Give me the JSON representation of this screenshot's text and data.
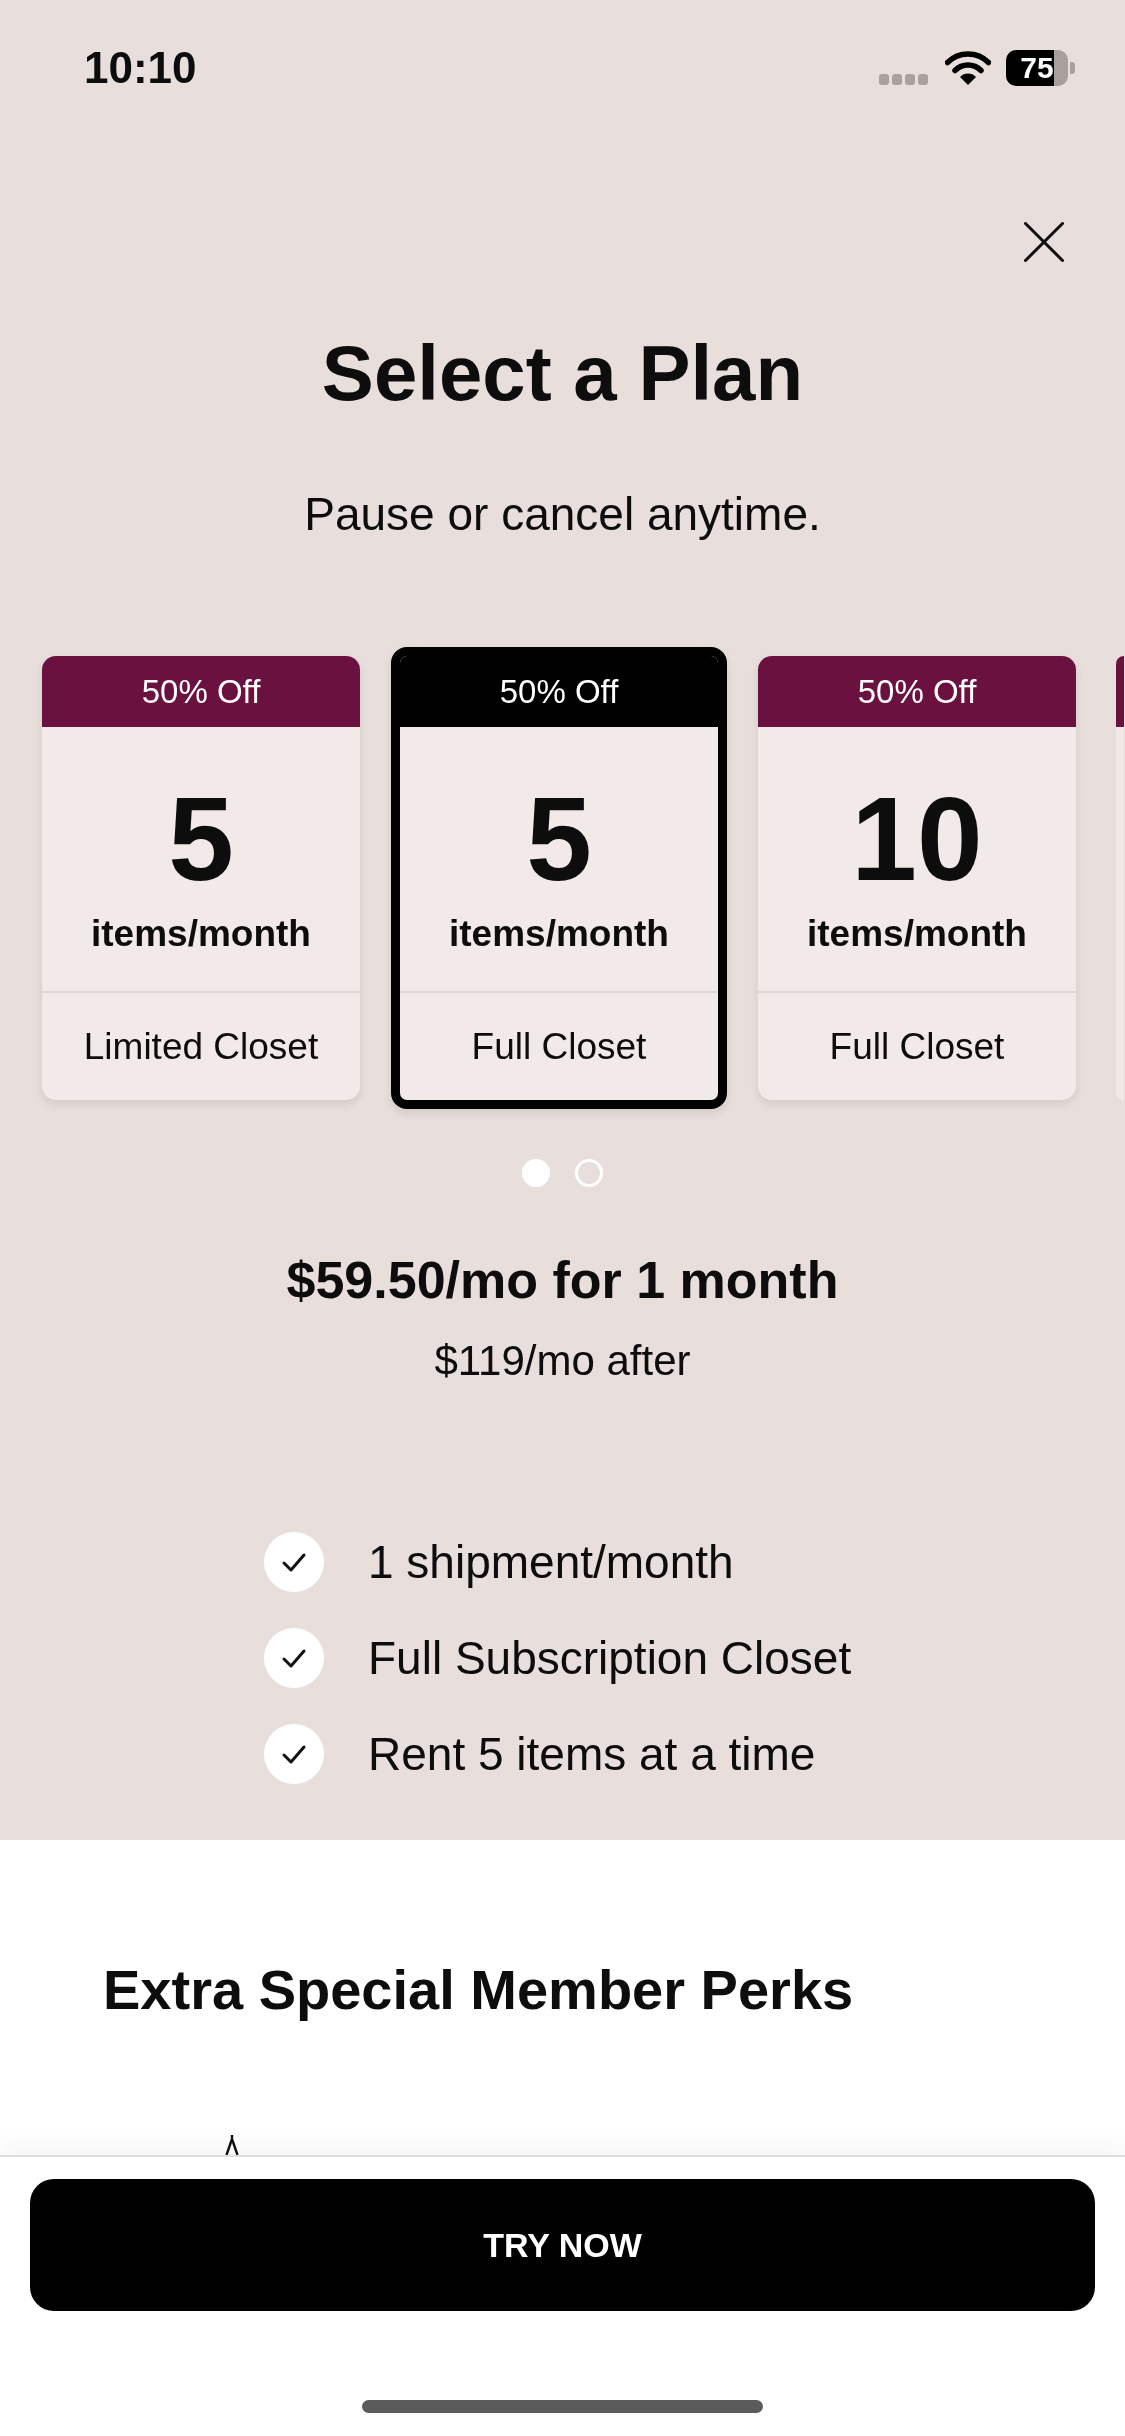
{
  "status_bar": {
    "time": "10:10",
    "battery": "75"
  },
  "title": "Select a Plan",
  "subtitle": "Pause or cancel anytime.",
  "plans": [
    {
      "badge": "50% Off",
      "count": "5",
      "unit": "items/month",
      "closet": "Limited Closet",
      "selected": false
    },
    {
      "badge": "50% Off",
      "count": "5",
      "unit": "items/month",
      "closet": "Full Closet",
      "selected": true
    },
    {
      "badge": "50% Off",
      "count": "10",
      "unit": "items/month",
      "closet": "Full Closet",
      "selected": false
    }
  ],
  "carousel": {
    "next_card_peek": true,
    "pages": [
      {
        "selected": true
      },
      {
        "selected": false
      }
    ]
  },
  "price": {
    "intro": "$59.50/mo for 1 month",
    "after": "$119/mo after"
  },
  "features": [
    "1 shipment/month",
    "Full Subscription Closet",
    "Rent 5 items at a time"
  ],
  "perks": {
    "title": "Extra Special Member Perks"
  },
  "cta": {
    "label": "TRY NOW"
  }
}
